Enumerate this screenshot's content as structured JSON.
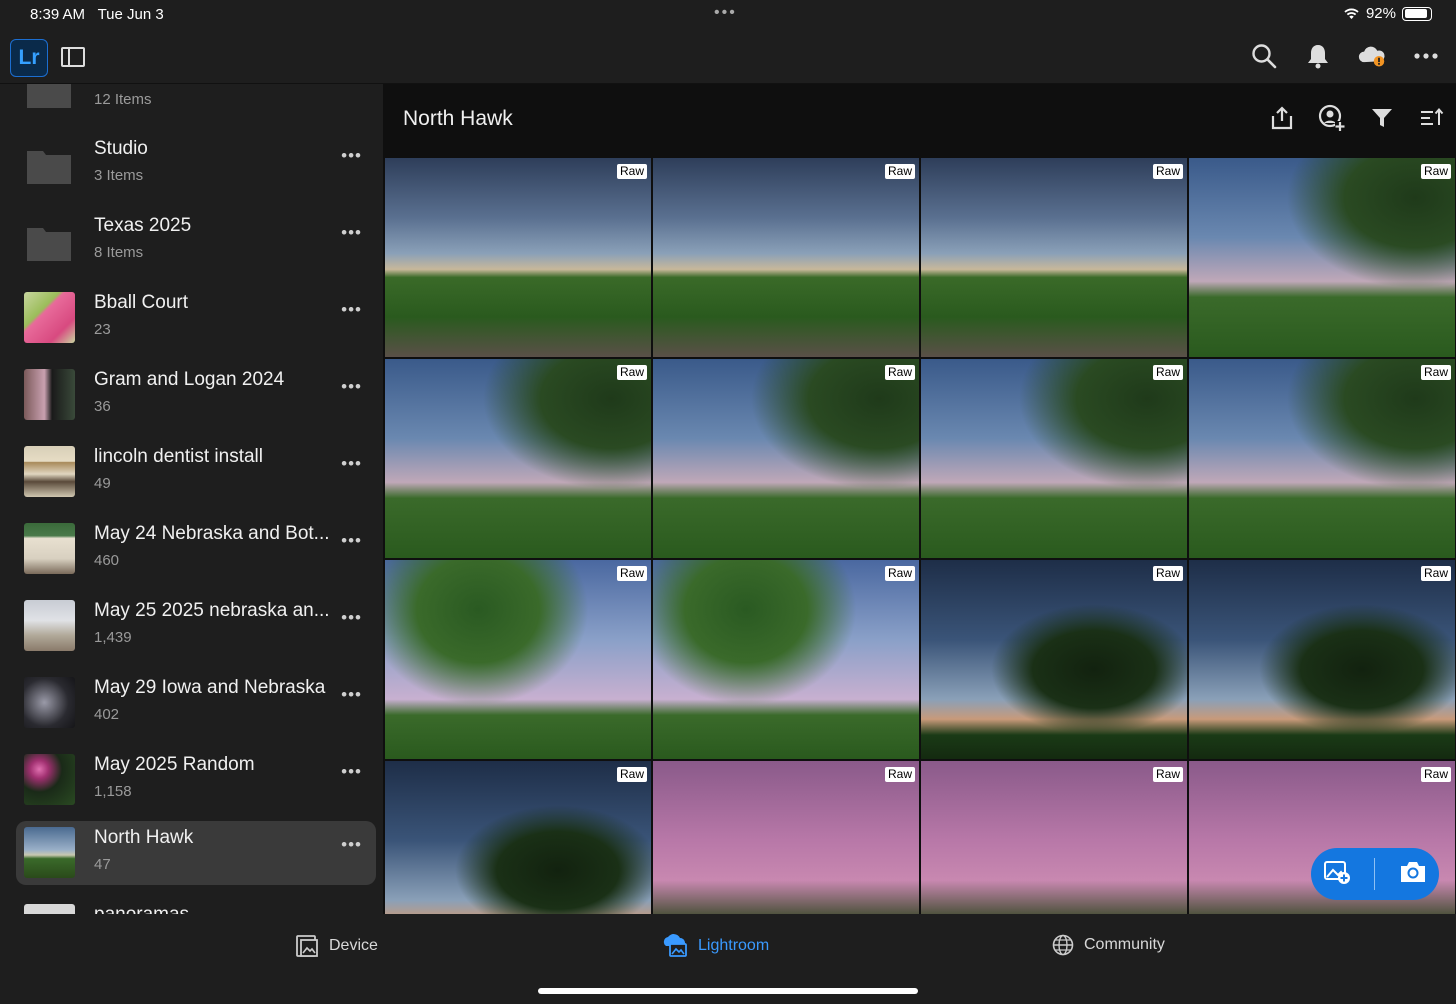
{
  "status": {
    "time": "8:39 AM",
    "date": "Tue Jun 3",
    "battery": "92%"
  },
  "app": {
    "logo": "Lr"
  },
  "sidebar": {
    "items": [
      {
        "name": "",
        "count": "12 Items",
        "kind": "folder"
      },
      {
        "name": "Studio",
        "count": "3 Items",
        "kind": "folder"
      },
      {
        "name": "Texas 2025",
        "count": "8 Items",
        "kind": "folder"
      },
      {
        "name": "Bball Court",
        "count": "23",
        "kind": "album"
      },
      {
        "name": "Gram and Logan 2024",
        "count": "36",
        "kind": "album"
      },
      {
        "name": "lincoln dentist install",
        "count": "49",
        "kind": "album"
      },
      {
        "name": "May 24 Nebraska and Bot...",
        "count": "460",
        "kind": "album"
      },
      {
        "name": "May 25 2025 nebraska an...",
        "count": "1,439",
        "kind": "album"
      },
      {
        "name": "May 29 Iowa and Nebraska",
        "count": "402",
        "kind": "album"
      },
      {
        "name": "May 2025 Random",
        "count": "1,158",
        "kind": "album"
      },
      {
        "name": "North Hawk",
        "count": "47",
        "kind": "album",
        "selected": true
      },
      {
        "name": "panoramas",
        "count": "",
        "kind": "album"
      }
    ]
  },
  "main": {
    "title": "North Hawk",
    "badge": "Raw",
    "photos": [
      "storm-road",
      "storm-road",
      "storm-road",
      "tree-storm",
      "tree-storm",
      "tree-storm",
      "tree-storm",
      "tree-storm",
      "tree-sky",
      "tree-sky",
      "tree-dark",
      "tree-dark",
      "tree-dark",
      "grass-pink",
      "grass-pink",
      "grass-pink"
    ]
  },
  "tabs": {
    "device": "Device",
    "lightroom": "Lightroom",
    "community": "Community"
  },
  "colors": {
    "accent": "#1477e0",
    "active_tab": "#3a9aff",
    "warning": "#f29423"
  }
}
